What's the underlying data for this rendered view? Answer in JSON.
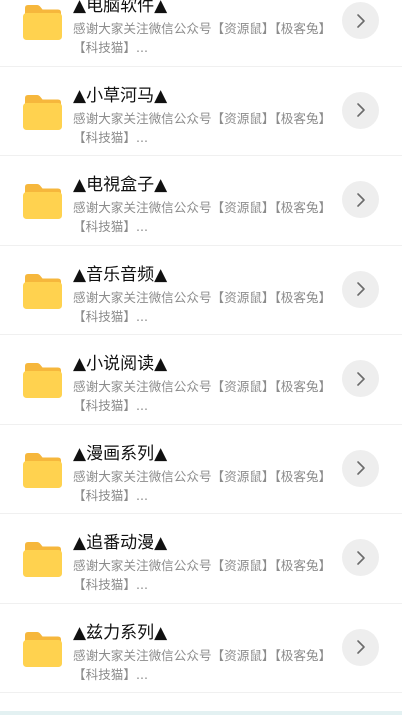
{
  "folders": [
    {
      "title": "▲电脑软件▲",
      "description": "感谢大家关注微信公众号【资源鼠】【极客兔】【科技猫】...",
      "icon": "folder-icon"
    },
    {
      "title": "▲小草河马▲",
      "description": "感谢大家关注微信公众号【资源鼠】【极客兔】【科技猫】...",
      "icon": "folder-icon"
    },
    {
      "title": "▲电視盒子▲",
      "description": "感谢大家关注微信公众号【资源鼠】【极客兔】【科技猫】...",
      "icon": "folder-icon"
    },
    {
      "title": "▲音乐音频▲",
      "description": "感谢大家关注微信公众号【资源鼠】【极客兔】【科技猫】...",
      "icon": "folder-icon"
    },
    {
      "title": "▲小说阅读▲",
      "description": "感谢大家关注微信公众号【资源鼠】【极客兔】【科技猫】...",
      "icon": "folder-icon"
    },
    {
      "title": "▲漫画系列▲",
      "description": "感谢大家关注微信公众号【资源鼠】【极客兔】【科技猫】...",
      "icon": "folder-icon"
    },
    {
      "title": "▲追番动漫▲",
      "description": "感谢大家关注微信公众号【资源鼠】【极客兔】【科技猫】...",
      "icon": "folder-icon"
    },
    {
      "title": "▲兹力系列▲",
      "description": "感谢大家关注微信公众号【资源鼠】【极客兔】【科技猫】...",
      "icon": "folder-icon"
    }
  ],
  "colors": {
    "folder_back": "#f6b73c",
    "folder_front": "#ffd24f",
    "button_bg": "#eeeeee",
    "chevron": "#6b6b6b",
    "title_text": "#111111",
    "desc_text": "#8c8c8c"
  },
  "icons": {
    "folder": "folder-icon",
    "open": "chevron-right-icon"
  }
}
